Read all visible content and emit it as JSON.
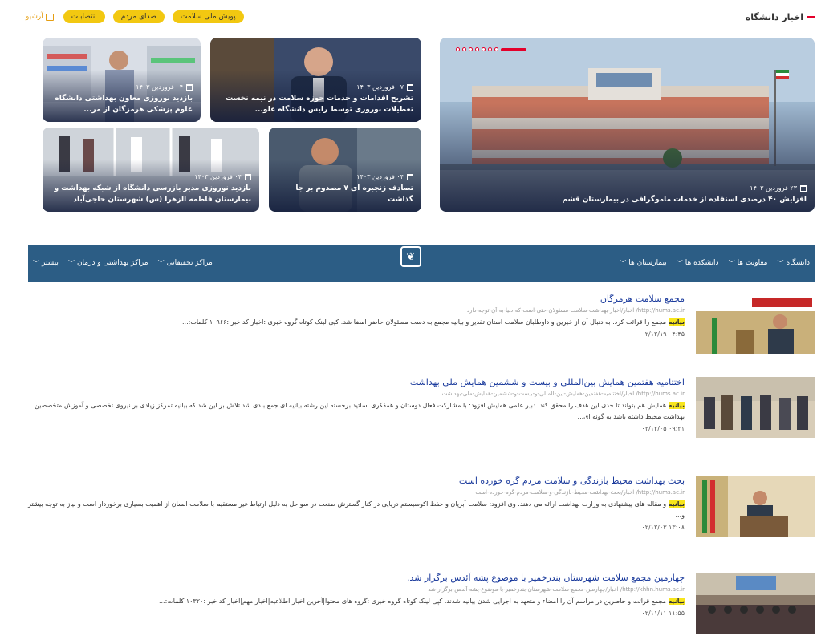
{
  "news": {
    "section_title": "اخبار دانشگاه",
    "tags": [
      "پویش ملی سلامت",
      "صدای مردم",
      "انتصابات"
    ],
    "archive_label": "آرشیو",
    "main_card": {
      "date": "۲۳ فروردین ۱۴۰۳",
      "headline": "افزایش ۴۰ درصدی استفاده از خدمات ماموگرافی در بیمارستان قشم"
    },
    "cards": [
      {
        "date": "۰۷ فروردین ۱۴۰۳",
        "headline": "تشریح اقدامات و خدمات حوزه سلامت در نیمه نخست تعطیلات نوروزی توسط رایس دانشگاه علو..."
      },
      {
        "date": "۰۴ فروردین ۱۴۰۳",
        "headline": "بازدید نوروزی معاون بهداشتی دانشگاه علوم پزشکی هرمزگان از مر..."
      },
      {
        "date": "۰۴ فروردین ۱۴۰۳",
        "headline": "تصادف زنجیره ای ۷ مصدوم بر جا گذاشت"
      },
      {
        "date": "۰۴ فروردین ۱۴۰۳",
        "headline": "بازدید نوروزی مدیر بازرسی دانشگاه از شبکه بهداشت و بیمارستان فاطمه الزهرا (س) شهرستان حاجی‌آباد"
      }
    ]
  },
  "navbar": {
    "right_items": [
      "دانشگاه",
      "معاونت ها",
      "دانشکده ها",
      "بیمارستان ها"
    ],
    "left_items": [
      "مراکز تحقیقاتی",
      "مراکز بهداشتی و درمان",
      "بیشتر"
    ]
  },
  "results": [
    {
      "title": "مجمع سلامت هرمزگان",
      "url": "http://hums.ac.ir/ اخبار/اخبار-بهداشت-سلامت-مسئولان-حتی-است-که-دنیا-به-آن-توجه-دارد",
      "snippet_before": "",
      "highlight": "بیانیه",
      "snippet_after": " مجمع را قرائت کرد. به دنبال آن از خیرین و داوطلبان سلامت استان تقدیر و بیانیه مجمع به دست مسئولان حاضر امضا شد. کپی لینک کوتاه گروه خبری :اخبار کد خبر :۱۰۹۶۶ کلمات:...",
      "date": "۰۴:۴۵ ۰۲/۱۲/۱۹"
    },
    {
      "title": "اختتامیه هفتمین همایش بین‌المللی و بیست و ششمین همایش ملی بهداشت",
      "url": "http://hums.ac.ir/ اخبار/اختتامیه-هفتمین-همایش-بین-المللی-و-بیست-و-ششمین-همایش-ملی-بهداشت",
      "snippet_before": "",
      "highlight": "بیانیه",
      "snippet_after": " همایش هم بتواند تا حدی این هدف را محقق کند. دبیر علمی همایش افزود: با مشارکت فعال دوستان و همفکری اساتید برجسته این رشته بیانیه ای جمع بندی شد تلاش بر این شد که بیانیه تمرکز زیادی بر نیروی تخصصی و آموزش متخصصین بهداشت محیط داشته باشد به گونه ای...",
      "date": "۰۹:۲۱ ۰۲/۱۲/۰۵"
    },
    {
      "title": "بحث بهداشت محیط بازندگی و سلامت مردم گره خورده است",
      "url": "http://hums.ac.ir/ اخبار/بحث-بهداشت-محیط-بازندگی-و-سلامت-مردم-گره-خورده-است",
      "snippet_before": "",
      "highlight": "بیانیه",
      "snippet_after": " و مقاله های پیشنهادی به وزارت بهداشت ارائه می دهند. وی افزود: سلامت آبزیان و حفظ اکوسیستم دریایی در کنار گسترش صنعت در سواحل به دلیل ارتباط غیر مستقیم با سلامت انسان از اهمیت بسیاری برخوردار است و نیاز به توجه بیشتر و...",
      "date": "۱۳:۰۸ ۰۲/۱۲/۰۳"
    },
    {
      "title": "چهارمین مجمع سلامت شهرستان بندرخمیر با موضوع پشه آئدس برگزار شد.",
      "url": "http://khhn.hums.ac.ir/ اخبار/چهارمین-مجمع-سلامت-شهرستان-بندرخمیر-با-موضوع-پشه-آئدس-برگزار-شد",
      "snippet_before": "",
      "highlight": "بیانیه",
      "snippet_after": " مجمع قرائت و حاضرین در مراسم آن را امضاء و متعهد به اجرایی شدن بیانیه شدند. کپی لینک کوتاه گروه خبری :گروه های محتوا|آخرین اخبار|اطلاعیه|اخبار مهم|اخبار کد خبر :۱۰۳۲۰ کلمات:...",
      "date": "۱۱:۵۵ ۰۲/۱۱/۱۱"
    }
  ],
  "colors": {
    "nav_bg": "#2c5d85",
    "accent_red": "#e4002b",
    "tag_yellow": "#f2c811",
    "link_blue": "#1a3a9c",
    "highlight": "#f7e51c"
  }
}
